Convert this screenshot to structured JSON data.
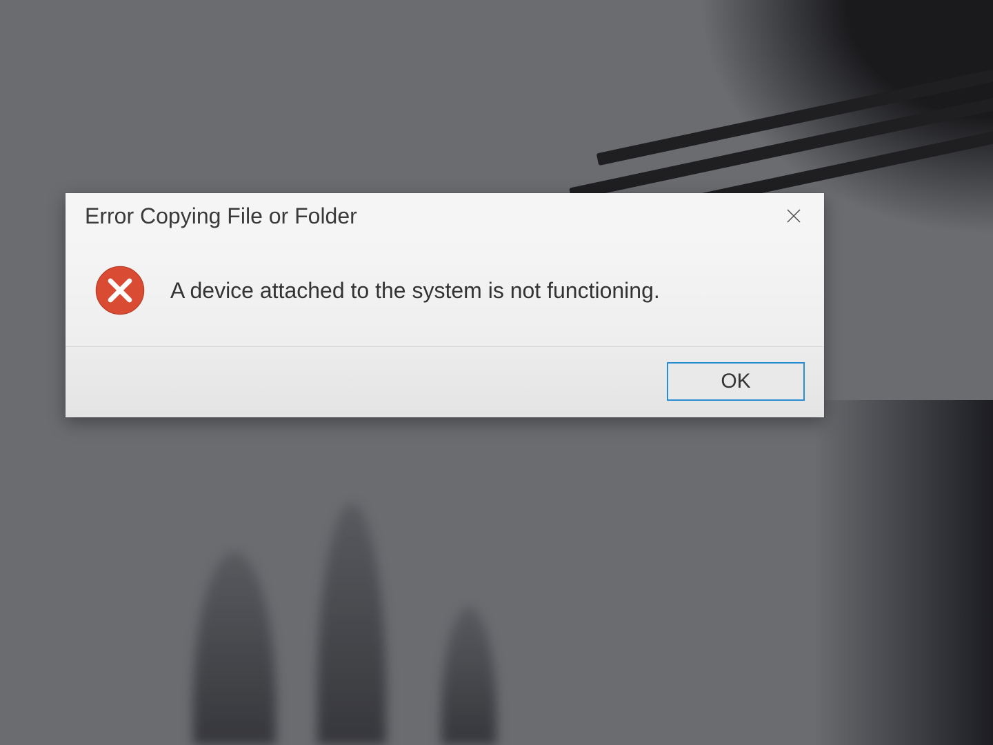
{
  "dialog": {
    "title": "Error Copying File or Folder",
    "message": "A device attached to the system is not functioning.",
    "ok_label": "OK"
  },
  "icons": {
    "error": "error-circle-x",
    "close": "close-x"
  },
  "colors": {
    "error_icon_bg": "#d94b32",
    "error_icon_fg": "#ffffff",
    "accent": "#2a8dd4",
    "dialog_bg": "#f0f0f0"
  }
}
